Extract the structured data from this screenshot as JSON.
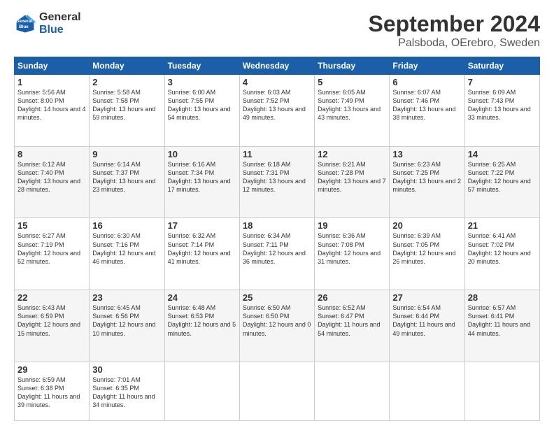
{
  "header": {
    "logo_line1": "General",
    "logo_line2": "Blue",
    "title": "September 2024",
    "subtitle": "Palsboda, OErebro, Sweden"
  },
  "days_of_week": [
    "Sunday",
    "Monday",
    "Tuesday",
    "Wednesday",
    "Thursday",
    "Friday",
    "Saturday"
  ],
  "weeks": [
    [
      {
        "day": "1",
        "sunrise": "Sunrise: 5:56 AM",
        "sunset": "Sunset: 8:00 PM",
        "daylight": "Daylight: 14 hours and 4 minutes."
      },
      {
        "day": "2",
        "sunrise": "Sunrise: 5:58 AM",
        "sunset": "Sunset: 7:58 PM",
        "daylight": "Daylight: 13 hours and 59 minutes."
      },
      {
        "day": "3",
        "sunrise": "Sunrise: 6:00 AM",
        "sunset": "Sunset: 7:55 PM",
        "daylight": "Daylight: 13 hours and 54 minutes."
      },
      {
        "day": "4",
        "sunrise": "Sunrise: 6:03 AM",
        "sunset": "Sunset: 7:52 PM",
        "daylight": "Daylight: 13 hours and 49 minutes."
      },
      {
        "day": "5",
        "sunrise": "Sunrise: 6:05 AM",
        "sunset": "Sunset: 7:49 PM",
        "daylight": "Daylight: 13 hours and 43 minutes."
      },
      {
        "day": "6",
        "sunrise": "Sunrise: 6:07 AM",
        "sunset": "Sunset: 7:46 PM",
        "daylight": "Daylight: 13 hours and 38 minutes."
      },
      {
        "day": "7",
        "sunrise": "Sunrise: 6:09 AM",
        "sunset": "Sunset: 7:43 PM",
        "daylight": "Daylight: 13 hours and 33 minutes."
      }
    ],
    [
      {
        "day": "8",
        "sunrise": "Sunrise: 6:12 AM",
        "sunset": "Sunset: 7:40 PM",
        "daylight": "Daylight: 13 hours and 28 minutes."
      },
      {
        "day": "9",
        "sunrise": "Sunrise: 6:14 AM",
        "sunset": "Sunset: 7:37 PM",
        "daylight": "Daylight: 13 hours and 23 minutes."
      },
      {
        "day": "10",
        "sunrise": "Sunrise: 6:16 AM",
        "sunset": "Sunset: 7:34 PM",
        "daylight": "Daylight: 13 hours and 17 minutes."
      },
      {
        "day": "11",
        "sunrise": "Sunrise: 6:18 AM",
        "sunset": "Sunset: 7:31 PM",
        "daylight": "Daylight: 13 hours and 12 minutes."
      },
      {
        "day": "12",
        "sunrise": "Sunrise: 6:21 AM",
        "sunset": "Sunset: 7:28 PM",
        "daylight": "Daylight: 13 hours and 7 minutes."
      },
      {
        "day": "13",
        "sunrise": "Sunrise: 6:23 AM",
        "sunset": "Sunset: 7:25 PM",
        "daylight": "Daylight: 13 hours and 2 minutes."
      },
      {
        "day": "14",
        "sunrise": "Sunrise: 6:25 AM",
        "sunset": "Sunset: 7:22 PM",
        "daylight": "Daylight: 12 hours and 57 minutes."
      }
    ],
    [
      {
        "day": "15",
        "sunrise": "Sunrise: 6:27 AM",
        "sunset": "Sunset: 7:19 PM",
        "daylight": "Daylight: 12 hours and 52 minutes."
      },
      {
        "day": "16",
        "sunrise": "Sunrise: 6:30 AM",
        "sunset": "Sunset: 7:16 PM",
        "daylight": "Daylight: 12 hours and 46 minutes."
      },
      {
        "day": "17",
        "sunrise": "Sunrise: 6:32 AM",
        "sunset": "Sunset: 7:14 PM",
        "daylight": "Daylight: 12 hours and 41 minutes."
      },
      {
        "day": "18",
        "sunrise": "Sunrise: 6:34 AM",
        "sunset": "Sunset: 7:11 PM",
        "daylight": "Daylight: 12 hours and 36 minutes."
      },
      {
        "day": "19",
        "sunrise": "Sunrise: 6:36 AM",
        "sunset": "Sunset: 7:08 PM",
        "daylight": "Daylight: 12 hours and 31 minutes."
      },
      {
        "day": "20",
        "sunrise": "Sunrise: 6:39 AM",
        "sunset": "Sunset: 7:05 PM",
        "daylight": "Daylight: 12 hours and 26 minutes."
      },
      {
        "day": "21",
        "sunrise": "Sunrise: 6:41 AM",
        "sunset": "Sunset: 7:02 PM",
        "daylight": "Daylight: 12 hours and 20 minutes."
      }
    ],
    [
      {
        "day": "22",
        "sunrise": "Sunrise: 6:43 AM",
        "sunset": "Sunset: 6:59 PM",
        "daylight": "Daylight: 12 hours and 15 minutes."
      },
      {
        "day": "23",
        "sunrise": "Sunrise: 6:45 AM",
        "sunset": "Sunset: 6:56 PM",
        "daylight": "Daylight: 12 hours and 10 minutes."
      },
      {
        "day": "24",
        "sunrise": "Sunrise: 6:48 AM",
        "sunset": "Sunset: 6:53 PM",
        "daylight": "Daylight: 12 hours and 5 minutes."
      },
      {
        "day": "25",
        "sunrise": "Sunrise: 6:50 AM",
        "sunset": "Sunset: 6:50 PM",
        "daylight": "Daylight: 12 hours and 0 minutes."
      },
      {
        "day": "26",
        "sunrise": "Sunrise: 6:52 AM",
        "sunset": "Sunset: 6:47 PM",
        "daylight": "Daylight: 11 hours and 54 minutes."
      },
      {
        "day": "27",
        "sunrise": "Sunrise: 6:54 AM",
        "sunset": "Sunset: 6:44 PM",
        "daylight": "Daylight: 11 hours and 49 minutes."
      },
      {
        "day": "28",
        "sunrise": "Sunrise: 6:57 AM",
        "sunset": "Sunset: 6:41 PM",
        "daylight": "Daylight: 11 hours and 44 minutes."
      }
    ],
    [
      {
        "day": "29",
        "sunrise": "Sunrise: 6:59 AM",
        "sunset": "Sunset: 6:38 PM",
        "daylight": "Daylight: 11 hours and 39 minutes."
      },
      {
        "day": "30",
        "sunrise": "Sunrise: 7:01 AM",
        "sunset": "Sunset: 6:35 PM",
        "daylight": "Daylight: 11 hours and 34 minutes."
      },
      null,
      null,
      null,
      null,
      null
    ]
  ]
}
